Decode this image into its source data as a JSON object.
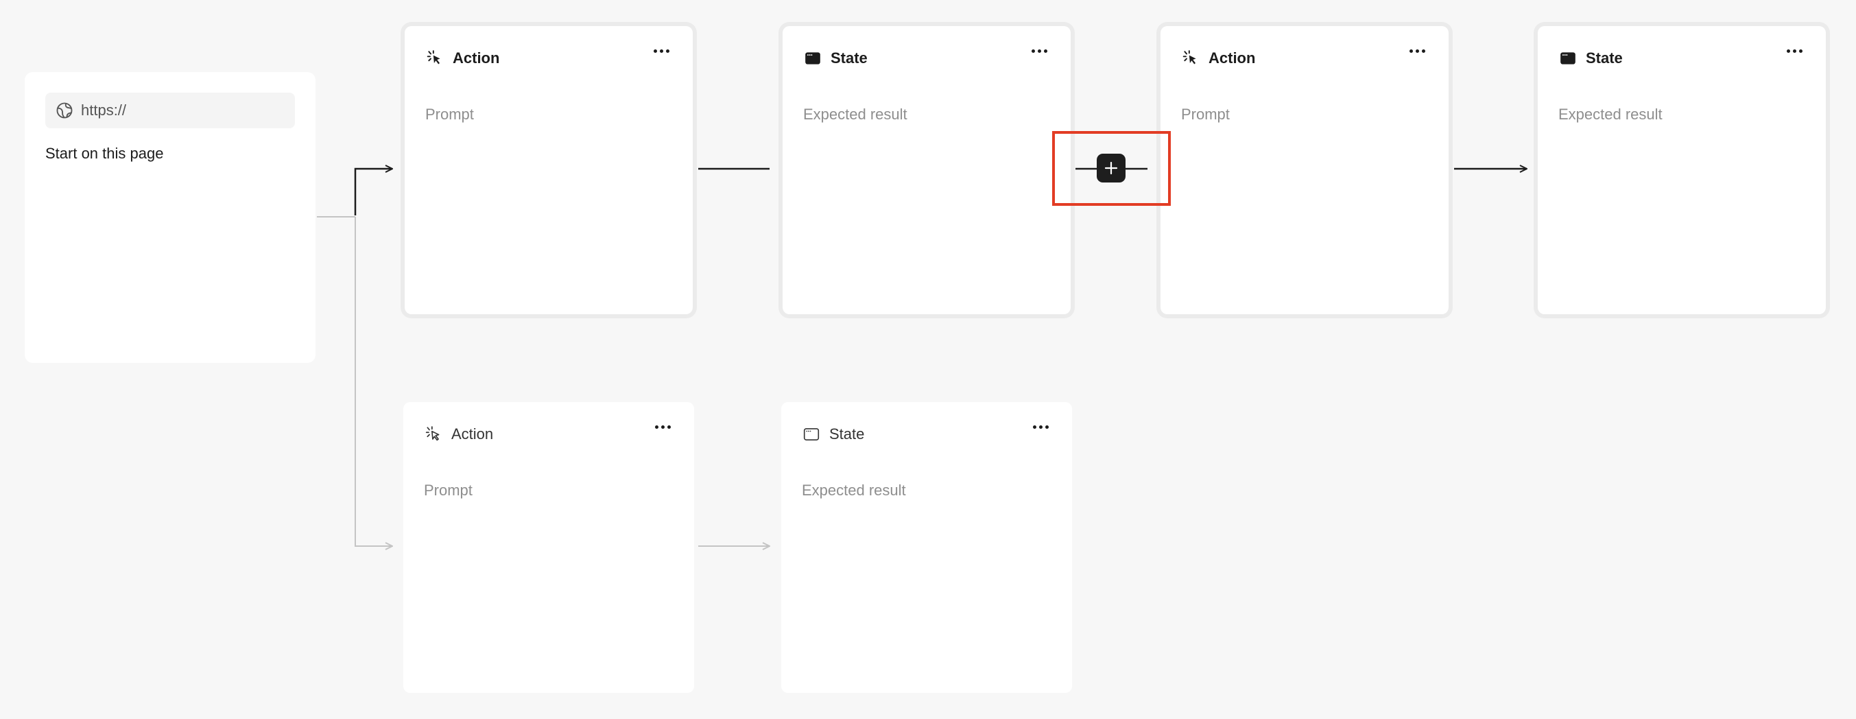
{
  "start": {
    "url_value": "https://",
    "caption": "Start on this page"
  },
  "nodes": {
    "top_action_1": {
      "title": "Action",
      "placeholder": "Prompt"
    },
    "top_state_1": {
      "title": "State",
      "placeholder": "Expected result"
    },
    "top_action_2": {
      "title": "Action",
      "placeholder": "Prompt"
    },
    "top_state_2": {
      "title": "State",
      "placeholder": "Expected result"
    },
    "bottom_action": {
      "title": "Action",
      "placeholder": "Prompt"
    },
    "bottom_state": {
      "title": "State",
      "placeholder": "Expected result"
    }
  },
  "colors": {
    "background": "#f7f7f7",
    "card": "#ffffff",
    "highlight": "#e23c24",
    "add_button": "#1e1e1e",
    "active_connector": "#1c1c1c",
    "inactive_connector": "#c4c4c4"
  },
  "icons": {
    "url": "globe-icon",
    "action": "cursor-click-icon",
    "state": "browser-window-icon",
    "menu": "more-horizontal-icon",
    "add": "plus-icon"
  }
}
